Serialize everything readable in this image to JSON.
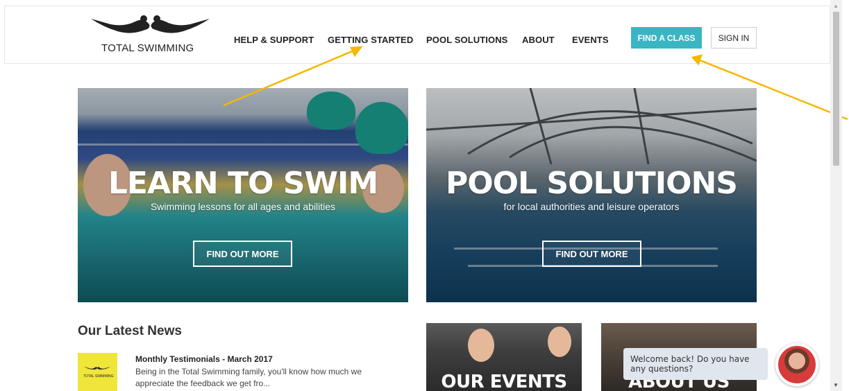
{
  "header": {
    "logo_text": "TOTAL SWIMMING",
    "nav": [
      {
        "label": "HELP & SUPPORT"
      },
      {
        "label": "GETTING STARTED"
      },
      {
        "label": "POOL SOLUTIONS"
      },
      {
        "label": "ABOUT"
      },
      {
        "label": "EVENTS"
      }
    ],
    "find_class_label": "FIND A CLASS",
    "sign_in_label": "SIGN IN"
  },
  "hero": {
    "left": {
      "title": "LEARN TO SWIM",
      "subtitle": "Swimming lessons for all ages and abilities",
      "button": "FIND OUT MORE"
    },
    "right": {
      "title": "POOL SOLUTIONS",
      "subtitle": "for local authorities and leisure operators",
      "button": "FIND OUT MORE"
    }
  },
  "news": {
    "section_title": "Our Latest News",
    "items": [
      {
        "thumb_text": "TOTAL SWIMMING",
        "title": "Monthly Testimonials - March 2017",
        "excerpt": "Being in the Total Swimming family, you'll know how much we appreciate the feedback we get fro..."
      }
    ]
  },
  "tiles": {
    "events": "OUR EVENTS",
    "about": "ABOUT US"
  },
  "chat": {
    "message": "Welcome back! Do you have any questions?"
  },
  "colors": {
    "accent": "#3bb5c3",
    "annotation_arrow": "#f5b800",
    "news_thumb": "#f0e53a"
  }
}
